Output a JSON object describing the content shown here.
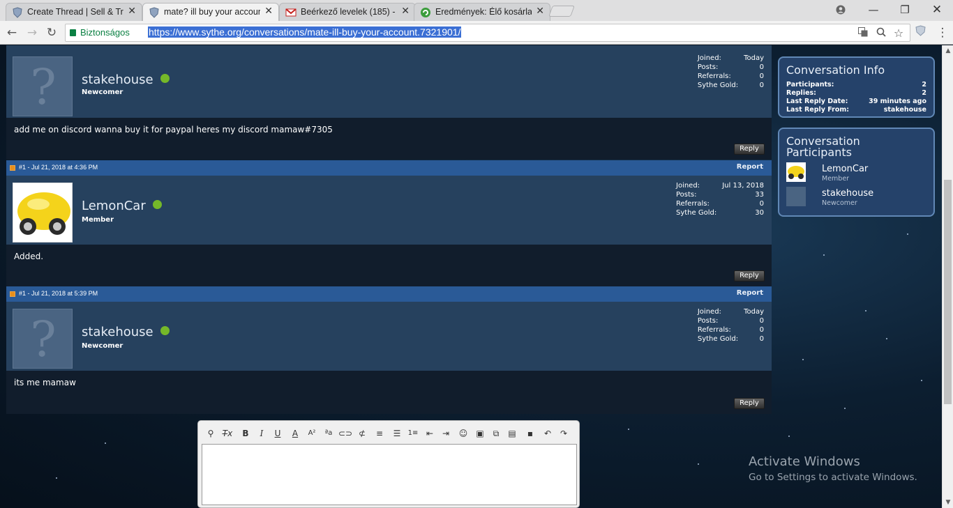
{
  "browser": {
    "tabs": [
      {
        "title": "Create Thread | Sell & Tra",
        "icon": "sythe-shield-icon"
      },
      {
        "title": "mate? ill buy your accoun",
        "icon": "sythe-shield-icon"
      },
      {
        "title": "Beérkező levelek (185) - ",
        "icon": "gmail-icon"
      },
      {
        "title": "Eredmények: Élő kosárlab",
        "icon": "livescore-icon"
      }
    ],
    "secure_label": "Biztonságos",
    "url": "https://www.sythe.org/conversations/mate-ill-buy-your-account.7321901/"
  },
  "messages": [
    {
      "header": null,
      "report": null,
      "username": "stakehouse",
      "role": "Newcomer",
      "avatar": "placeholder",
      "stats": [
        {
          "label": "Joined:",
          "value": "Today"
        },
        {
          "label": "Posts:",
          "value": "0"
        },
        {
          "label": "Referrals:",
          "value": "0"
        },
        {
          "label": "Sythe Gold:",
          "value": "0"
        }
      ],
      "text": "add me on discord wanna buy it for paypal heres my discord mamaw#7305",
      "reply": "Reply"
    },
    {
      "header": "#1 - Jul 21, 2018 at 4:36 PM",
      "report": "Report",
      "username": "LemonCar",
      "role": "Member",
      "avatar": "lemon-car",
      "stats": [
        {
          "label": "Joined:",
          "value": "Jul 13, 2018"
        },
        {
          "label": "Posts:",
          "value": "33"
        },
        {
          "label": "Referrals:",
          "value": "0"
        },
        {
          "label": "Sythe Gold:",
          "value": "30"
        }
      ],
      "text": "Added.",
      "reply": "Reply"
    },
    {
      "header": "#1 - Jul 21, 2018 at 5:39 PM",
      "report": "Report",
      "username": "stakehouse",
      "role": "Newcomer",
      "avatar": "placeholder",
      "stats": [
        {
          "label": "Joined:",
          "value": "Today"
        },
        {
          "label": "Posts:",
          "value": "0"
        },
        {
          "label": "Referrals:",
          "value": "0"
        },
        {
          "label": "Sythe Gold:",
          "value": "0"
        }
      ],
      "text": "its me mamaw",
      "reply": "Reply"
    }
  ],
  "conversation_info": {
    "title": "Conversation Info",
    "rows": [
      {
        "label": "Participants:",
        "value": "2"
      },
      {
        "label": "Replies:",
        "value": "2"
      },
      {
        "label": "Last Reply Date:",
        "value": "39 minutes ago"
      },
      {
        "label": "Last Reply From:",
        "value": "stakehouse"
      }
    ]
  },
  "participants": {
    "title_line1": "Conversation",
    "title_line2": "Participants",
    "list": [
      {
        "name": "LemonCar",
        "role": "Member"
      },
      {
        "name": "stakehouse",
        "role": "Newcomer"
      }
    ]
  },
  "windows_watermark": {
    "line1": "Activate Windows",
    "line2": "Go to Settings to activate Windows."
  },
  "colors": {
    "header_blue": "#2a5a97",
    "user_panel": "#26415e",
    "online_green": "#75b829",
    "secure_green": "#0b8043",
    "url_selection": "#3b6fd4"
  }
}
